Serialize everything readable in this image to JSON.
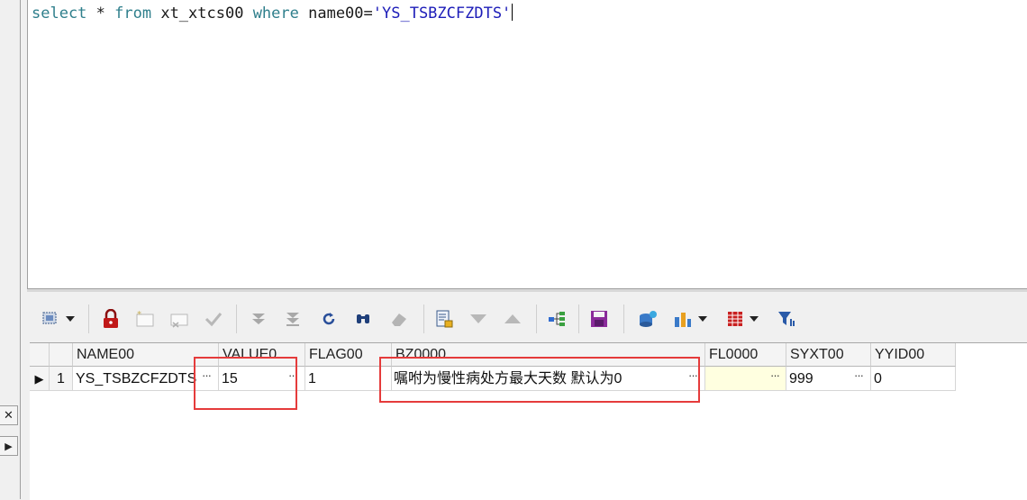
{
  "editor": {
    "sql_select": "select",
    "sql_star": " * ",
    "sql_from": "from",
    "sql_table": " xt_xtcs00 ",
    "sql_where": "where",
    "sql_cond": " name00=",
    "sql_value": "'YS_TSBZCFZDTS'"
  },
  "gutter": {
    "close_glyph": "✕",
    "arrow_glyph": "▶"
  },
  "toolbar": {
    "icons": [
      "grid-select-icon",
      "lock-icon",
      "add-record-icon",
      "delete-record-icon",
      "post-icon",
      "last-icon",
      "first-icon",
      "refresh-icon",
      "find-icon",
      "clear-icon",
      "report-icon",
      "down-icon",
      "up-icon",
      "tree-icon",
      "save-icon",
      "database-export-icon",
      "chart-icon",
      "table-icon",
      "filter-icon"
    ]
  },
  "grid": {
    "columns": [
      "NAME00",
      "VALUE0",
      "FLAG00",
      "BZ0000",
      "FL0000",
      "SYXT00",
      "YYID00"
    ],
    "rows": [
      {
        "indicator": "▶",
        "num": "1",
        "NAME00": "YS_TSBZCFZDTS",
        "VALUE0": "15",
        "FLAG00": "1",
        "BZ0000": "嘱咐为慢性病处方最大天数  默认为0",
        "FL0000": "",
        "SYXT00": "999",
        "YYID00": "0"
      }
    ],
    "ellipsis": "···"
  },
  "colors": {
    "keyword": "#2f7f8c",
    "string": "#1c1cb8",
    "highlight_box": "#e53b3b",
    "fl0000_cell_bg": "#ffffe0"
  }
}
